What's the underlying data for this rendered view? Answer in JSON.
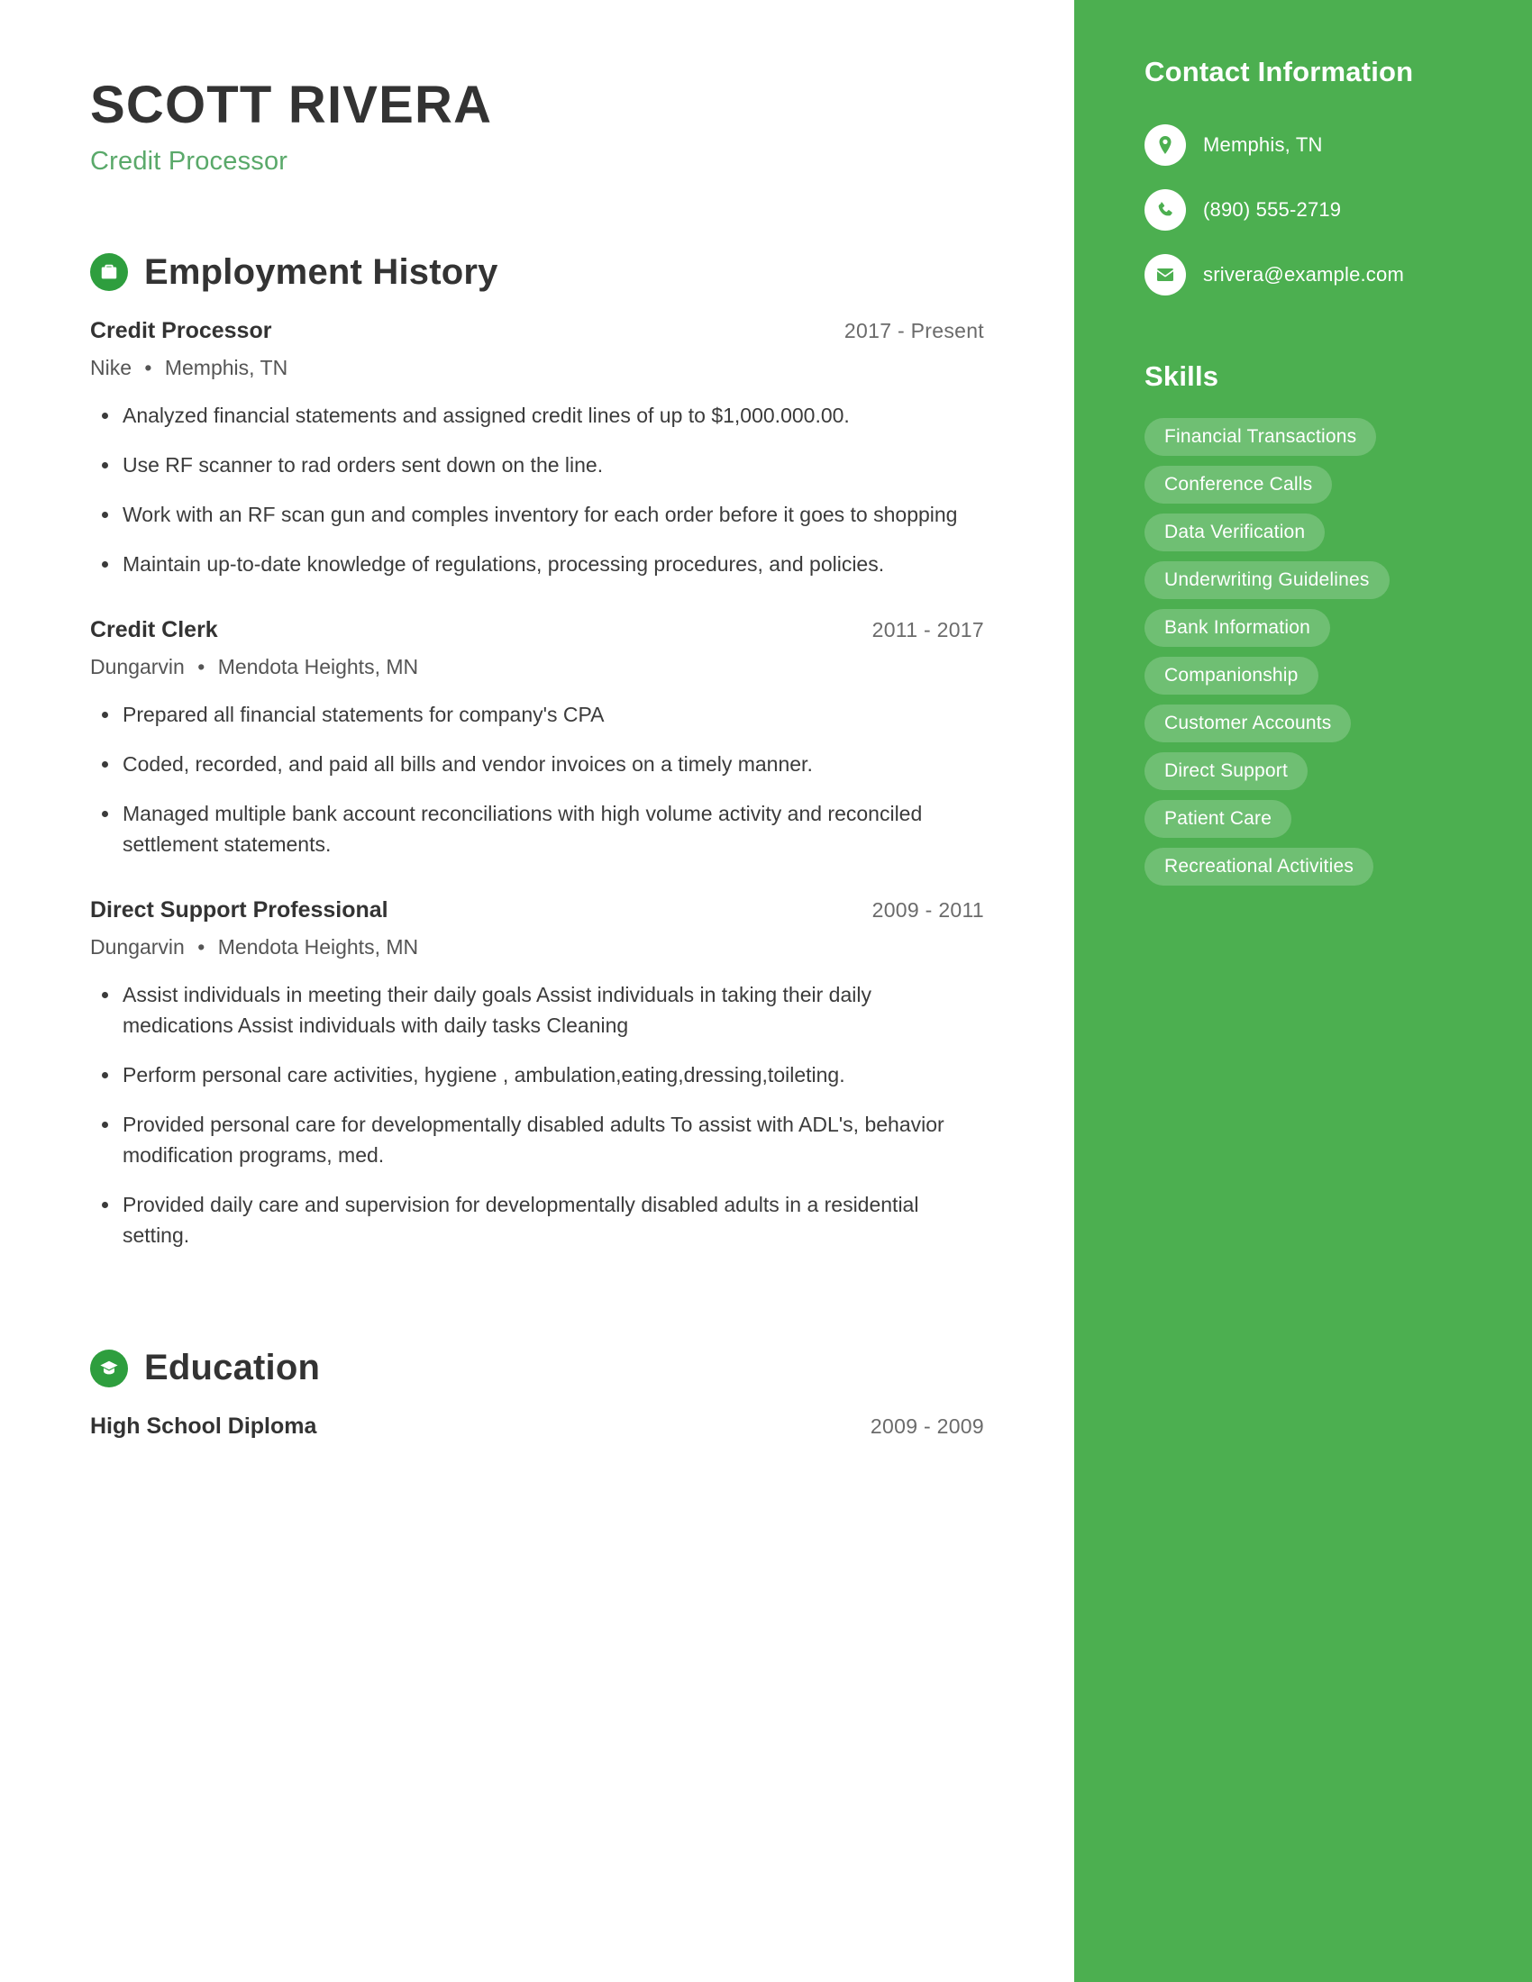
{
  "header": {
    "name": "SCOTT RIVERA",
    "title": "Credit Processor"
  },
  "sections": {
    "employment": {
      "title": "Employment History",
      "icon": "briefcase-icon"
    },
    "education": {
      "title": "Education",
      "icon": "graduation-cap-icon"
    }
  },
  "employment": [
    {
      "role": "Credit Processor",
      "date": "2017 - Present",
      "company": "Nike",
      "separator": "•",
      "location": "Memphis, TN",
      "bullets": [
        "Analyzed financial statements and assigned credit lines of up to $1,000.000.00.",
        "Use RF scanner to rad orders sent down on the line.",
        "Work with an RF scan gun and comples inventory for each order before it goes to shopping",
        "Maintain up-to-date knowledge of regulations, processing procedures, and policies."
      ]
    },
    {
      "role": "Credit Clerk",
      "date": "2011 - 2017",
      "company": "Dungarvin",
      "separator": "•",
      "location": "Mendota Heights, MN",
      "bullets": [
        "Prepared all financial statements for company's CPA",
        "Coded, recorded, and paid all bills and vendor invoices on a timely manner.",
        "Managed multiple bank account reconciliations with high volume activity and reconciled settlement statements."
      ]
    },
    {
      "role": "Direct Support Professional",
      "date": "2009 - 2011",
      "company": "Dungarvin",
      "separator": "•",
      "location": "Mendota Heights, MN",
      "bullets": [
        "Assist individuals in meeting their daily goals Assist individuals in taking their daily medications Assist individuals with daily tasks Cleaning",
        "Perform personal care activities, hygiene , ambulation,eating,dressing,toileting.",
        "Provided personal care for developmentally disabled adults To assist with ADL's, behavior modification programs, med.",
        "Provided daily care and supervision for developmentally disabled adults in a residential setting."
      ]
    }
  ],
  "education": [
    {
      "degree": "High School Diploma",
      "date": "2009 - 2009"
    }
  ],
  "sidebar": {
    "contact_title": "Contact Information",
    "skills_title": "Skills",
    "contact": [
      {
        "icon": "location-pin-icon",
        "value": "Memphis, TN"
      },
      {
        "icon": "phone-icon",
        "value": "(890) 555-2719"
      },
      {
        "icon": "envelope-icon",
        "value": "srivera@example.com"
      }
    ],
    "skills": [
      "Financial Transactions",
      "Conference Calls",
      "Data Verification",
      "Underwriting Guidelines",
      "Bank Information",
      "Companionship",
      "Customer Accounts",
      "Direct Support",
      "Patient Care",
      "Recreational Activities"
    ]
  },
  "colors": {
    "accent_green": "#4caf50",
    "icon_green": "#2e9e3e",
    "title_green": "#5aa96a",
    "text_dark": "#333333"
  }
}
